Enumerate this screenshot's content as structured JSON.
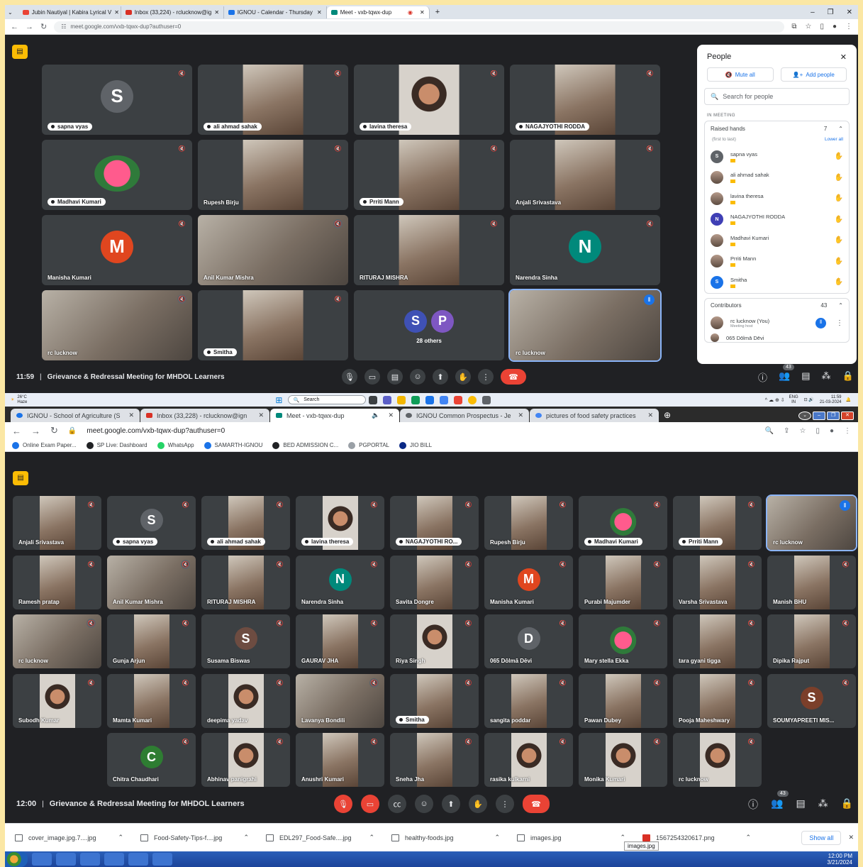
{
  "top_window": {
    "tabs": [
      {
        "label": "Jubin Nautiyal | Kabira Lyrical V",
        "color": "#ea4335"
      },
      {
        "label": "Inbox (33,224) - rclucknow@ig",
        "color": "#d93025"
      },
      {
        "label": "IGNOU - Calendar - Thursday",
        "color": "#1a73e8"
      },
      {
        "label": "Meet - vxb-tqwx-dup",
        "color": "#00897b"
      }
    ],
    "url": "meet.google.com/vxb-tqwx-dup?authuser=0",
    "tiles": [
      {
        "name": "sapna vyas",
        "style": "pill",
        "avatar": "S",
        "avatar_color": "#5f6368"
      },
      {
        "name": "ali ahmad sahak",
        "style": "pill",
        "photo": "person"
      },
      {
        "name": "lavina theresa",
        "style": "pill",
        "photo": "face"
      },
      {
        "name": "NAGAJYOTHI RODDA",
        "style": "pill",
        "photo": "person"
      },
      {
        "name": "Madhavi Kumari",
        "style": "pill",
        "photo": "flower"
      },
      {
        "name": "Rupesh Birju",
        "style": "plain",
        "photo": "person"
      },
      {
        "name": "Prriti Mann",
        "style": "pill",
        "photo": "person"
      },
      {
        "name": "Anjali Srivastava",
        "style": "plain",
        "photo": "person"
      },
      {
        "name": "Manisha Kumari",
        "style": "plain",
        "avatar": "M",
        "avatar_color": "#e0461f"
      },
      {
        "name": "Anil Kumar Mishra",
        "style": "plain",
        "photo": "wide"
      },
      {
        "name": "RITURAJ MISHRA",
        "style": "plain",
        "photo": "person"
      },
      {
        "name": "Narendra Sinha",
        "style": "plain",
        "avatar": "N",
        "avatar_color": "#00897b"
      },
      {
        "name": "rc lucknow",
        "style": "plain",
        "photo": "wide"
      },
      {
        "name": "Smitha",
        "style": "pill",
        "photo": "person"
      },
      {
        "name": "28 others",
        "style": "others"
      },
      {
        "name": "rc lucknow",
        "style": "plain",
        "photo": "wide",
        "active": true
      }
    ],
    "others_avatars": [
      {
        "letter": "S",
        "color": "#3f51b5"
      },
      {
        "letter": "P",
        "color": "#7e57c2"
      }
    ],
    "time": "11:59",
    "meeting_title": "Grievance & Redressal Meeting for MHDOL Learners",
    "participants_badge": "43",
    "people": {
      "title": "People",
      "mute_all": "Mute all",
      "add_people": "Add people",
      "search_placeholder": "Search for people",
      "section": "IN MEETING",
      "raised_hands": "Raised hands",
      "raised_count": "7",
      "order": "(first to last)",
      "lower_all": "Lower all",
      "hands": [
        {
          "name": "sapna vyas",
          "initial": "S",
          "color": "#5f6368"
        },
        {
          "name": "ali ahmad sahak",
          "initial": "",
          "color": ""
        },
        {
          "name": "lavina theresa",
          "initial": "",
          "color": ""
        },
        {
          "name": "NAGAJYOTHI RODDA",
          "initial": "N",
          "color": "#3f3fb5"
        },
        {
          "name": "Madhavi Kumari",
          "initial": "",
          "color": ""
        },
        {
          "name": "Prriti Mann",
          "initial": "",
          "color": ""
        },
        {
          "name": "Smitha",
          "initial": "S",
          "color": "#1a73e8"
        }
      ],
      "contributors": "Contributors",
      "contributors_count": "43",
      "host_name": "rc lucknow (You)",
      "host_role": "Meeting host",
      "next_partial": "065 Dōlmā Dēvi"
    },
    "taskbar": {
      "weather": "26°C",
      "weather_sub": "Haze",
      "search": "Search",
      "lang": "ENG",
      "lang_sub": "IN",
      "time": "11:59",
      "date": "21-03-2024"
    }
  },
  "bottom_window": {
    "tabs": [
      {
        "label": "IGNOU - School of Agriculture (S",
        "color": "#1a73e8"
      },
      {
        "label": "Inbox (33,228) - rclucknow@ign",
        "color": "#d93025"
      },
      {
        "label": "Meet - vxb-tqwx-dup",
        "color": "#00897b"
      },
      {
        "label": "IGNOU Common Prospectus - Je",
        "color": "#5f6368"
      },
      {
        "label": "pictures of food safety practices",
        "color": "#4285f4"
      }
    ],
    "url": "meet.google.com/vxb-tqwx-dup?authuser=0",
    "bookmarks": [
      "Online Exam Paper...",
      "SP Live: Dashboard",
      "WhatsApp",
      "SAMARTH-IGNOU",
      "BED ADMISSION C...",
      "PGPORTAL",
      "JIO BILL"
    ],
    "tiles": [
      [
        {
          "name": "Anjali Srivastava",
          "style": "plain",
          "photo": "person"
        },
        {
          "name": "sapna vyas",
          "style": "pill",
          "avatar": "S",
          "avatar_color": "#5f6368"
        },
        {
          "name": "ali ahmad sahak",
          "style": "pill",
          "photo": "person"
        },
        {
          "name": "lavina theresa",
          "style": "pill",
          "photo": "face"
        },
        {
          "name": "NAGAJYOTHI RO...",
          "style": "pill",
          "photo": "person"
        },
        {
          "name": "Rupesh Birju",
          "style": "plain",
          "photo": "person"
        },
        {
          "name": "Madhavi Kumari",
          "style": "pill",
          "photo": "flower"
        },
        {
          "name": "Prriti Mann",
          "style": "pill",
          "photo": "person"
        },
        {
          "name": "rc lucknow",
          "style": "plain",
          "photo": "wide",
          "active": true
        }
      ],
      [
        {
          "name": "Ramesh pratap",
          "style": "plain",
          "photo": "person"
        },
        {
          "name": "Anil Kumar Mishra",
          "style": "plain",
          "photo": "wide"
        },
        {
          "name": "RITURAJ MISHRA",
          "style": "plain",
          "photo": "person"
        },
        {
          "name": "Narendra Sinha",
          "style": "plain",
          "avatar": "N",
          "avatar_color": "#00897b"
        },
        {
          "name": "Savita Dongre",
          "style": "plain",
          "photo": "person"
        },
        {
          "name": "Manisha Kumari",
          "style": "plain",
          "avatar": "M",
          "avatar_color": "#e0461f"
        },
        {
          "name": "Purabi Majumder",
          "style": "plain",
          "photo": "person"
        },
        {
          "name": "Varsha Srivastava",
          "style": "plain",
          "photo": "person"
        },
        {
          "name": "Manish BHU",
          "style": "plain",
          "photo": "person"
        }
      ],
      [
        {
          "name": "rc lucknow",
          "style": "plain",
          "photo": "wide"
        },
        {
          "name": "Gunja Arjun",
          "style": "plain",
          "photo": "person"
        },
        {
          "name": "Susama Biswas",
          "style": "plain",
          "avatar": "S",
          "avatar_color": "#6d4c41"
        },
        {
          "name": "GAURAV JHA",
          "style": "plain",
          "photo": "person"
        },
        {
          "name": "Riya Singh",
          "style": "plain",
          "photo": "face"
        },
        {
          "name": "065 Dōlmā Dēvi",
          "style": "plain",
          "avatar": "D",
          "avatar_color": "#5f6368"
        },
        {
          "name": "Mary stella Ekka",
          "style": "plain",
          "photo": "flower"
        },
        {
          "name": "tara gyani tigga",
          "style": "plain",
          "photo": "person"
        },
        {
          "name": "Dipika Rajput",
          "style": "plain",
          "photo": "person"
        }
      ],
      [
        {
          "name": "Subodh Kumar",
          "style": "plain",
          "photo": "face"
        },
        {
          "name": "Mamta Kumari",
          "style": "plain",
          "photo": "person"
        },
        {
          "name": "deepima yadav",
          "style": "plain",
          "photo": "face"
        },
        {
          "name": "Lavanya Bondili",
          "style": "plain",
          "photo": "wide"
        },
        {
          "name": "Smitha",
          "style": "pill",
          "photo": "person"
        },
        {
          "name": "sangita poddar",
          "style": "plain",
          "photo": "person"
        },
        {
          "name": "Pawan Dubey",
          "style": "plain",
          "photo": "person"
        },
        {
          "name": "Pooja Maheshwary",
          "style": "plain",
          "photo": "person"
        },
        {
          "name": "SOUMYAPREETI MIS...",
          "style": "plain",
          "avatar": "S",
          "avatar_color": "#7b3f2a"
        }
      ],
      [
        {
          "name": "Chitra Chaudhari",
          "style": "plain",
          "avatar": "C",
          "avatar_color": "#2e7d32"
        },
        {
          "name": "Abhinav panigrahi",
          "style": "plain",
          "photo": "face"
        },
        {
          "name": "Anushri Kumari",
          "style": "plain",
          "photo": "person"
        },
        {
          "name": "Sneha Jha",
          "style": "plain",
          "photo": "person"
        },
        {
          "name": "rasika kulkarni",
          "style": "plain",
          "photo": "face"
        },
        {
          "name": "Monika Kumari",
          "style": "plain",
          "photo": "face"
        },
        {
          "name": "rc lucknow",
          "style": "plain",
          "photo": "face"
        }
      ]
    ],
    "time": "12:00",
    "meeting_title": "Grievance & Redressal Meeting for MHDOL Learners",
    "participants_badge": "43",
    "downloads": [
      "cover_image.jpg.7....jpg",
      "Food-Safety-Tips-f....jpg",
      "EDL297_Food-Safe....jpg",
      "healthy-foods.jpg",
      "images.jpg",
      "1567254320617.png"
    ],
    "show_all": "Show all",
    "tooltip": "images.jpg",
    "clock_time": "12:00 PM",
    "clock_date": "3/21/2024"
  }
}
